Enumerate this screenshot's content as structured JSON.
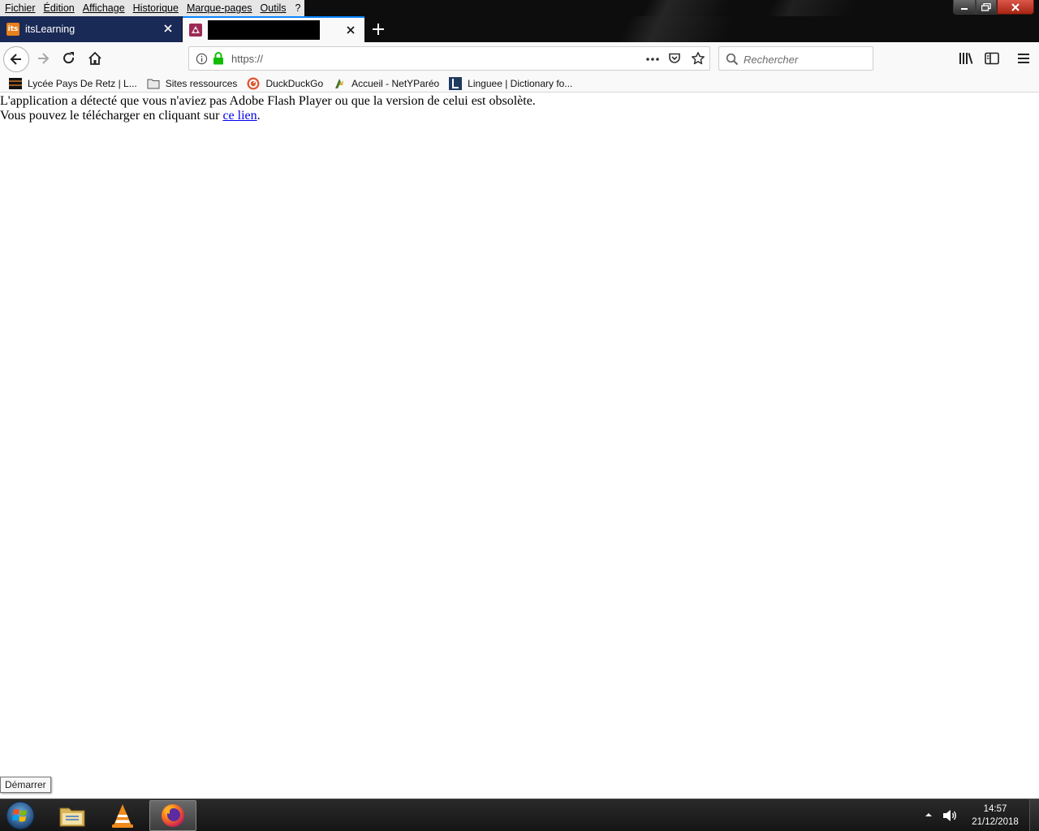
{
  "menubar": {
    "items": [
      "Fichier",
      "Édition",
      "Affichage",
      "Historique",
      "Marque-pages",
      "Outils",
      "?"
    ]
  },
  "tabs": [
    {
      "label": "itsLearning",
      "active": false,
      "favicon": "its-icon"
    },
    {
      "label": "",
      "active": true,
      "favicon": "site-icon",
      "title_redacted": true
    }
  ],
  "navbar": {
    "url": "https://",
    "search_placeholder": "Rechercher"
  },
  "bookmarks": [
    {
      "label": "Lycée Pays De Retz | L...",
      "icon": "school-icon"
    },
    {
      "label": "Sites ressources",
      "icon": "folder-icon"
    },
    {
      "label": "DuckDuckGo",
      "icon": "duckduckgo-icon"
    },
    {
      "label": "Accueil - NetYParéo",
      "icon": "netypareo-icon"
    },
    {
      "label": "Linguee | Dictionary fo...",
      "icon": "linguee-icon"
    }
  ],
  "content": {
    "line1": "L'application a détecté que vous n'aviez pas Adobe Flash Player ou que la version de celui est obsolète.",
    "line2_prefix": "Vous pouvez le télécharger en cliquant sur ",
    "link_text": "ce lien",
    "line2_suffix": "."
  },
  "tooltip": "Démarrer",
  "taskbar": {
    "time": "14:57",
    "date": "21/12/2018"
  },
  "colors": {
    "tab_active_accent": "#0a84ff",
    "link": "#0000ee",
    "lock_green": "#12bc00",
    "inactive_tab_bg": "#1a2a56"
  }
}
